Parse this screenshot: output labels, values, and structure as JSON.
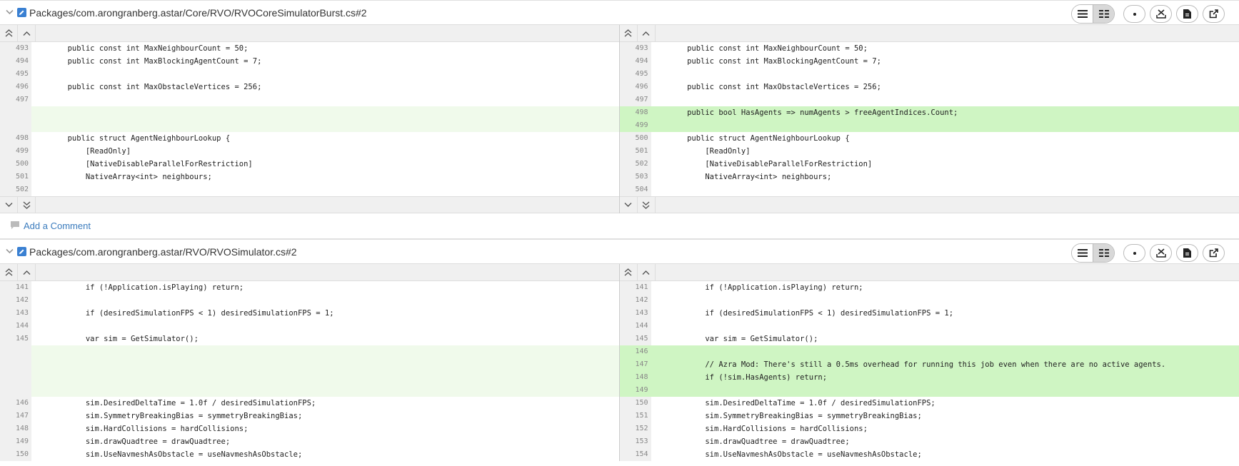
{
  "comment_label": "Add a Comment",
  "files": [
    {
      "path": "Packages/com.arongranberg.astar/Core/RVO/RVOCoreSimulatorBurst.cs#2",
      "left_rows": [
        {
          "n": "493",
          "code": "        public const int MaxNeighbourCount = 50;",
          "t": "ctx"
        },
        {
          "n": "494",
          "code": "        public const int MaxBlockingAgentCount = 7;",
          "t": "ctx"
        },
        {
          "n": "495",
          "code": "",
          "t": "ctx"
        },
        {
          "n": "496",
          "code": "        public const int MaxObstacleVertices = 256;",
          "t": "ctx"
        },
        {
          "n": "497",
          "code": "",
          "t": "ctx"
        },
        {
          "n": "",
          "code": "",
          "t": "pad"
        },
        {
          "n": "",
          "code": "",
          "t": "pad"
        },
        {
          "n": "498",
          "code": "        public struct AgentNeighbourLookup {",
          "t": "ctx"
        },
        {
          "n": "499",
          "code": "            [ReadOnly]",
          "t": "ctx"
        },
        {
          "n": "500",
          "code": "            [NativeDisableParallelForRestriction]",
          "t": "ctx"
        },
        {
          "n": "501",
          "code": "            NativeArray<int> neighbours;",
          "t": "ctx"
        },
        {
          "n": "502",
          "code": "",
          "t": "ctx"
        }
      ],
      "right_rows": [
        {
          "n": "493",
          "code": "        public const int MaxNeighbourCount = 50;",
          "t": "ctx"
        },
        {
          "n": "494",
          "code": "        public const int MaxBlockingAgentCount = 7;",
          "t": "ctx"
        },
        {
          "n": "495",
          "code": "",
          "t": "ctx"
        },
        {
          "n": "496",
          "code": "        public const int MaxObstacleVertices = 256;",
          "t": "ctx"
        },
        {
          "n": "497",
          "code": "",
          "t": "ctx"
        },
        {
          "n": "498",
          "code": "        public bool HasAgents => numAgents > freeAgentIndices.Count;",
          "t": "add"
        },
        {
          "n": "499",
          "code": "",
          "t": "add"
        },
        {
          "n": "500",
          "code": "        public struct AgentNeighbourLookup {",
          "t": "ctx"
        },
        {
          "n": "501",
          "code": "            [ReadOnly]",
          "t": "ctx"
        },
        {
          "n": "502",
          "code": "            [NativeDisableParallelForRestriction]",
          "t": "ctx"
        },
        {
          "n": "503",
          "code": "            NativeArray<int> neighbours;",
          "t": "ctx"
        },
        {
          "n": "504",
          "code": "",
          "t": "ctx"
        }
      ]
    },
    {
      "path": "Packages/com.arongranberg.astar/RVO/RVOSimulator.cs#2",
      "left_rows": [
        {
          "n": "141",
          "code": "            if (!Application.isPlaying) return;",
          "t": "ctx"
        },
        {
          "n": "142",
          "code": "",
          "t": "ctx"
        },
        {
          "n": "143",
          "code": "            if (desiredSimulationFPS < 1) desiredSimulationFPS = 1;",
          "t": "ctx"
        },
        {
          "n": "144",
          "code": "",
          "t": "ctx"
        },
        {
          "n": "145",
          "code": "            var sim = GetSimulator();",
          "t": "ctx"
        },
        {
          "n": "",
          "code": "",
          "t": "pad"
        },
        {
          "n": "",
          "code": "",
          "t": "pad"
        },
        {
          "n": "",
          "code": "",
          "t": "pad"
        },
        {
          "n": "",
          "code": "",
          "t": "pad"
        },
        {
          "n": "146",
          "code": "            sim.DesiredDeltaTime = 1.0f / desiredSimulationFPS;",
          "t": "ctx"
        },
        {
          "n": "147",
          "code": "            sim.SymmetryBreakingBias = symmetryBreakingBias;",
          "t": "ctx"
        },
        {
          "n": "148",
          "code": "            sim.HardCollisions = hardCollisions;",
          "t": "ctx"
        },
        {
          "n": "149",
          "code": "            sim.drawQuadtree = drawQuadtree;",
          "t": "ctx"
        },
        {
          "n": "150",
          "code": "            sim.UseNavmeshAsObstacle = useNavmeshAsObstacle;",
          "t": "ctx"
        }
      ],
      "right_rows": [
        {
          "n": "141",
          "code": "            if (!Application.isPlaying) return;",
          "t": "ctx"
        },
        {
          "n": "142",
          "code": "",
          "t": "ctx"
        },
        {
          "n": "143",
          "code": "            if (desiredSimulationFPS < 1) desiredSimulationFPS = 1;",
          "t": "ctx"
        },
        {
          "n": "144",
          "code": "",
          "t": "ctx"
        },
        {
          "n": "145",
          "code": "            var sim = GetSimulator();",
          "t": "ctx"
        },
        {
          "n": "146",
          "code": "",
          "t": "add"
        },
        {
          "n": "147",
          "code": "            // Azra Mod: There's still a 0.5ms overhead for running this job even when there are no active agents.",
          "t": "add"
        },
        {
          "n": "148",
          "code": "            if (!sim.HasAgents) return;",
          "t": "add"
        },
        {
          "n": "149",
          "code": "",
          "t": "add"
        },
        {
          "n": "150",
          "code": "            sim.DesiredDeltaTime = 1.0f / desiredSimulationFPS;",
          "t": "ctx"
        },
        {
          "n": "151",
          "code": "            sim.SymmetryBreakingBias = symmetryBreakingBias;",
          "t": "ctx"
        },
        {
          "n": "152",
          "code": "            sim.HardCollisions = hardCollisions;",
          "t": "ctx"
        },
        {
          "n": "153",
          "code": "            sim.drawQuadtree = drawQuadtree;",
          "t": "ctx"
        },
        {
          "n": "154",
          "code": "            sim.UseNavmeshAsObstacle = useNavmeshAsObstacle;",
          "t": "ctx"
        }
      ]
    }
  ]
}
